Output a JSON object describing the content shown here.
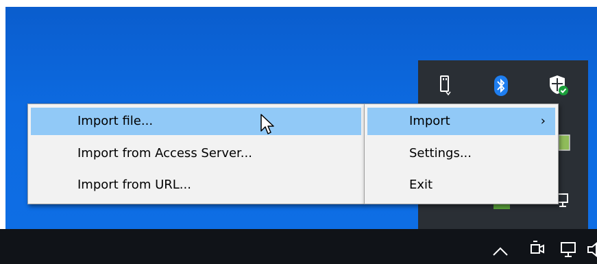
{
  "desktop": {
    "accent_color": "#0e6fe6"
  },
  "tray_flyout": {
    "icons": [
      "usb-drive-icon",
      "bluetooth-icon",
      "security-shield-icon"
    ]
  },
  "main_menu": {
    "items": [
      {
        "label": "Import",
        "has_submenu": true,
        "highlighted": true
      },
      {
        "label": "Settings...",
        "has_submenu": false,
        "highlighted": false
      },
      {
        "label": "Exit",
        "has_submenu": false,
        "highlighted": false
      }
    ],
    "arrow_glyph": "›"
  },
  "import_submenu": {
    "items": [
      {
        "label": "Import file...",
        "highlighted": true
      },
      {
        "label": "Import from Access Server...",
        "highlighted": false
      },
      {
        "label": "Import from URL...",
        "highlighted": false
      }
    ]
  },
  "taskbar": {
    "icons": [
      "chevron-up-icon",
      "camera-icon",
      "network-icon"
    ]
  },
  "highlight_color": "#91c9f7"
}
